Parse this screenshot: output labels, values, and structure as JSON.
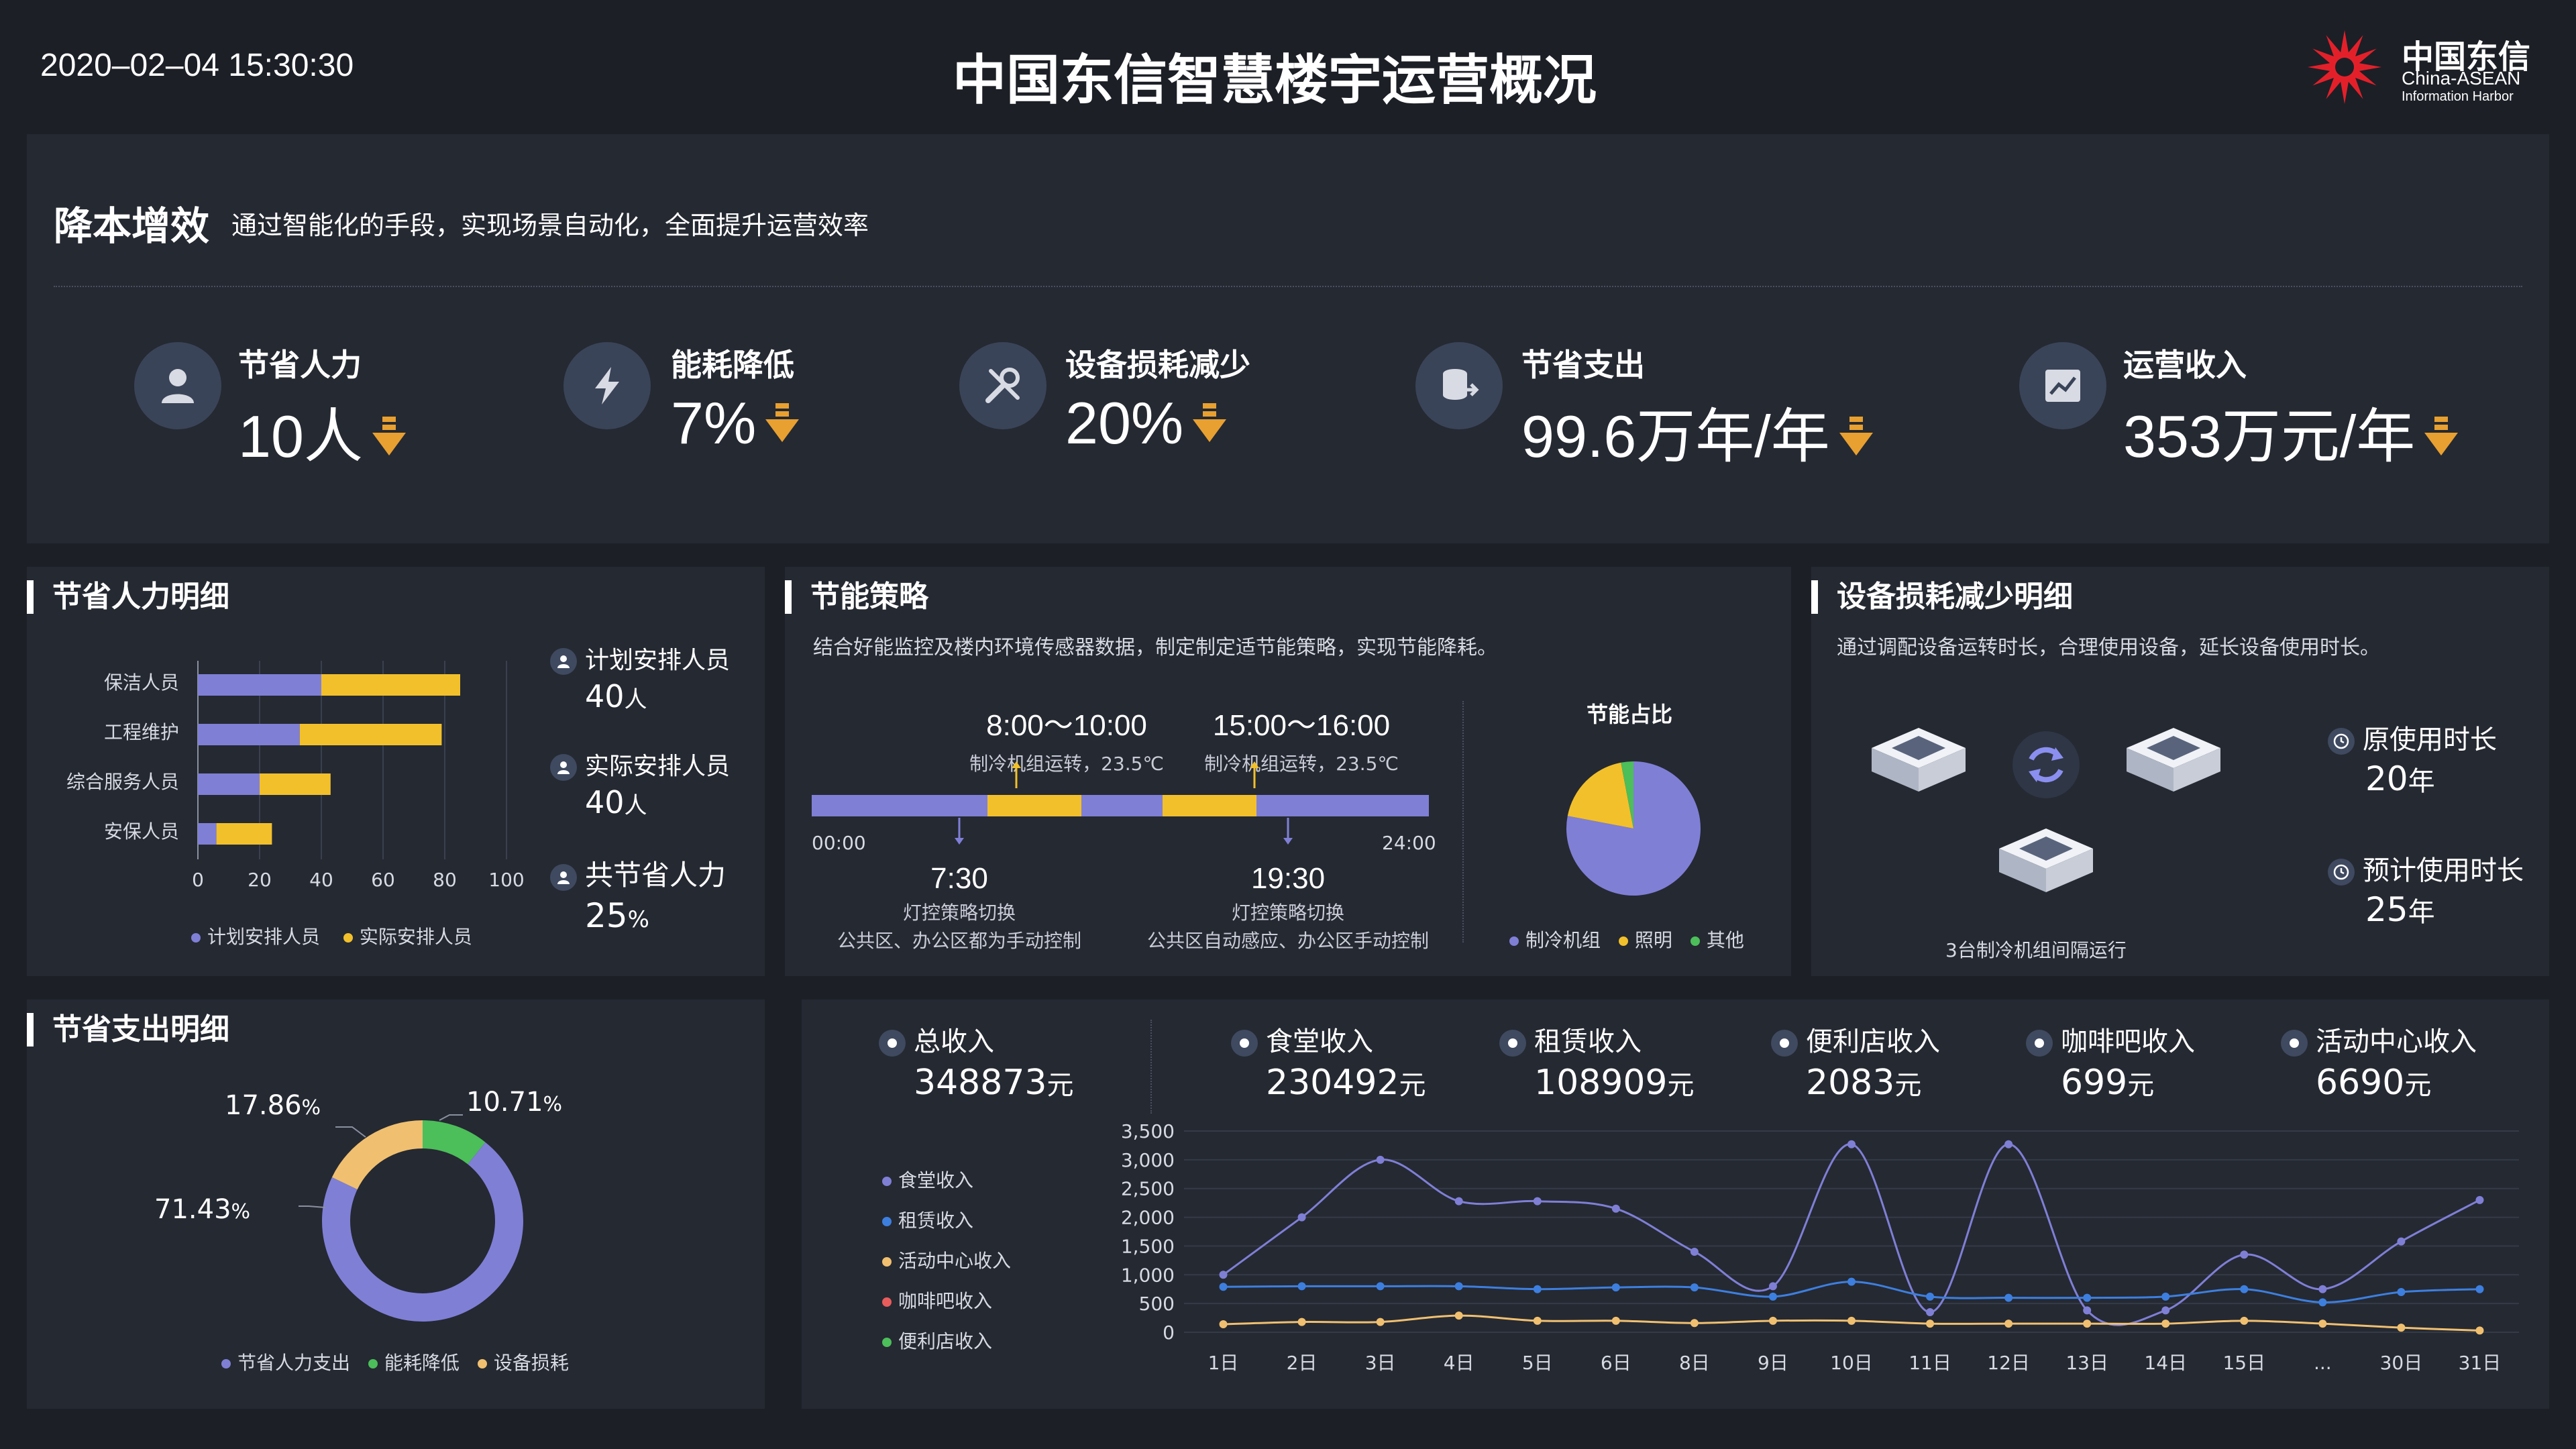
{
  "header": {
    "datetime": "2020–02–04 15:30:30",
    "title": "中国东信智慧楼宇运营概况",
    "logo_cn": "中国东信",
    "logo_en1": "China-ASEAN",
    "logo_en2": "Information Harbor"
  },
  "top": {
    "title": "降本增效",
    "subtitle": "通过智能化的手段，实现场景自动化，全面提升运营效率",
    "kpis": [
      {
        "label": "节省人力",
        "value": "10人",
        "icon": "person-icon"
      },
      {
        "label": "能耗降低",
        "value": "7%",
        "icon": "lightning-icon"
      },
      {
        "label": "设备损耗减少",
        "value": "20%",
        "icon": "tools-icon"
      },
      {
        "label": "节省支出",
        "value": "99.6万年/年",
        "icon": "coins-icon"
      },
      {
        "label": "运营收入",
        "value": "353万元/年",
        "icon": "chart-icon"
      }
    ]
  },
  "manpower": {
    "title": "节省人力明细",
    "rows": [
      "保洁人员",
      "工程维护",
      "综合服务人员",
      "安保人员"
    ],
    "ticks": [
      "0",
      "20",
      "40",
      "60",
      "80",
      "100"
    ],
    "legend": [
      "计划安排人员",
      "实际安排人员"
    ],
    "side": [
      {
        "label": "计划安排人员",
        "value": "40",
        "unit": "人"
      },
      {
        "label": "实际安排人员",
        "value": "40",
        "unit": "人"
      },
      {
        "label": "共节省人力",
        "value": "25",
        "unit": "%"
      }
    ]
  },
  "energy": {
    "title": "节能策略",
    "subtitle": "结合好能监控及楼内环境传感器数据，制定制定适节能策略，实现节能降耗。",
    "top_marks": [
      {
        "time": "8:00～10:00",
        "desc": "制冷机组运转，23.5℃"
      },
      {
        "time": "15:00～16:00",
        "desc": "制冷机组运转，23.5℃"
      }
    ],
    "bottom_marks": [
      {
        "time": "7:30",
        "desc1": "灯控策略切换",
        "desc2": "公共区、办公区都为手动控制"
      },
      {
        "time": "19:30",
        "desc1": "灯控策略切换",
        "desc2": "公共区自动感应、办公区手动控制"
      }
    ],
    "start": "00:00",
    "end": "24:00",
    "pie_title": "节能占比",
    "pie_legend": [
      "制冷机组",
      "照明",
      "其他"
    ]
  },
  "equipment": {
    "title": "设备损耗减少明细",
    "subtitle": "通过调配设备运转时长，合理使用设备，延长设备使用时长。",
    "caption": "3台制冷机组间隔运行",
    "items": [
      {
        "label": "原使用时长",
        "value": "20",
        "unit": "年"
      },
      {
        "label": "预计使用时长",
        "value": "25",
        "unit": "年"
      }
    ]
  },
  "expense": {
    "title": "节省支出明细",
    "labels": [
      {
        "text": "17.86",
        "unit": "%"
      },
      {
        "text": "10.71",
        "unit": "%"
      },
      {
        "text": "71.43",
        "unit": "%"
      }
    ],
    "legend": [
      "节省人力支出",
      "能耗降低",
      "设备损耗"
    ]
  },
  "revenue": {
    "stats": [
      {
        "label": "总收入",
        "value": "348873",
        "unit": "元"
      },
      {
        "label": "食堂收入",
        "value": "230492",
        "unit": "元"
      },
      {
        "label": "租赁收入",
        "value": "108909",
        "unit": "元"
      },
      {
        "label": "便利店收入",
        "value": "2083",
        "unit": "元"
      },
      {
        "label": "咖啡吧收入",
        "value": "699",
        "unit": "元"
      },
      {
        "label": "活动中心收入",
        "value": "6690",
        "unit": "元"
      }
    ],
    "legend": [
      "食堂收入",
      "租赁收入",
      "活动中心收入",
      "咖啡吧收入",
      "便利店收入"
    ]
  },
  "colors": {
    "purple": "#7f7fd6",
    "yellow": "#f2c02b",
    "green": "#4cbe5a",
    "blue": "#3d7fdf",
    "orange": "#f0c070",
    "red": "#e85c5c"
  },
  "chart_data": [
    {
      "type": "bar",
      "orientation": "horizontal",
      "stacked": true,
      "categories": [
        "保洁人员",
        "工程维护",
        "综合服务人员",
        "安保人员"
      ],
      "series": [
        {
          "name": "计划安排人员",
          "values": [
            40,
            33,
            20,
            6
          ]
        },
        {
          "name": "实际安排人员",
          "values": [
            45,
            46,
            23,
            18
          ]
        }
      ],
      "xlim": [
        0,
        100
      ],
      "legend": "bottom"
    },
    {
      "type": "pie",
      "title": "节能占比",
      "categories": [
        "制冷机组",
        "照明",
        "其他"
      ],
      "values": [
        78,
        19,
        3
      ],
      "legend": "bottom"
    },
    {
      "type": "pie",
      "donut": true,
      "categories": [
        "节省人力支出",
        "能耗降低",
        "设备损耗"
      ],
      "values": [
        71.43,
        10.71,
        17.86
      ],
      "legend": "bottom"
    },
    {
      "type": "line",
      "x": [
        "1日",
        "2日",
        "3日",
        "4日",
        "5日",
        "6日",
        "8日",
        "9日",
        "10日",
        "11日",
        "12日",
        "13日",
        "14日",
        "15日",
        "...",
        "30日",
        "31日"
      ],
      "yticks": [
        "0",
        "500",
        "1,000",
        "1,500",
        "2,000",
        "2,500",
        "3,000",
        "3,500"
      ],
      "ylim": [
        0,
        3500
      ],
      "series": [
        {
          "name": "食堂收入",
          "values": [
            1000,
            2000,
            3000,
            2280,
            2280,
            2150,
            1400,
            800,
            3270,
            350,
            3270,
            380,
            380,
            1350,
            750,
            1580,
            2300
          ]
        },
        {
          "name": "租赁收入",
          "values": [
            790,
            800,
            800,
            800,
            750,
            780,
            780,
            620,
            880,
            620,
            600,
            600,
            620,
            750,
            520,
            700,
            750
          ]
        },
        {
          "name": "活动中心收入",
          "values": [
            140,
            180,
            180,
            290,
            200,
            200,
            160,
            200,
            200,
            150,
            150,
            150,
            150,
            200,
            150,
            80,
            30
          ]
        }
      ],
      "grid": true,
      "legend": "left"
    }
  ]
}
